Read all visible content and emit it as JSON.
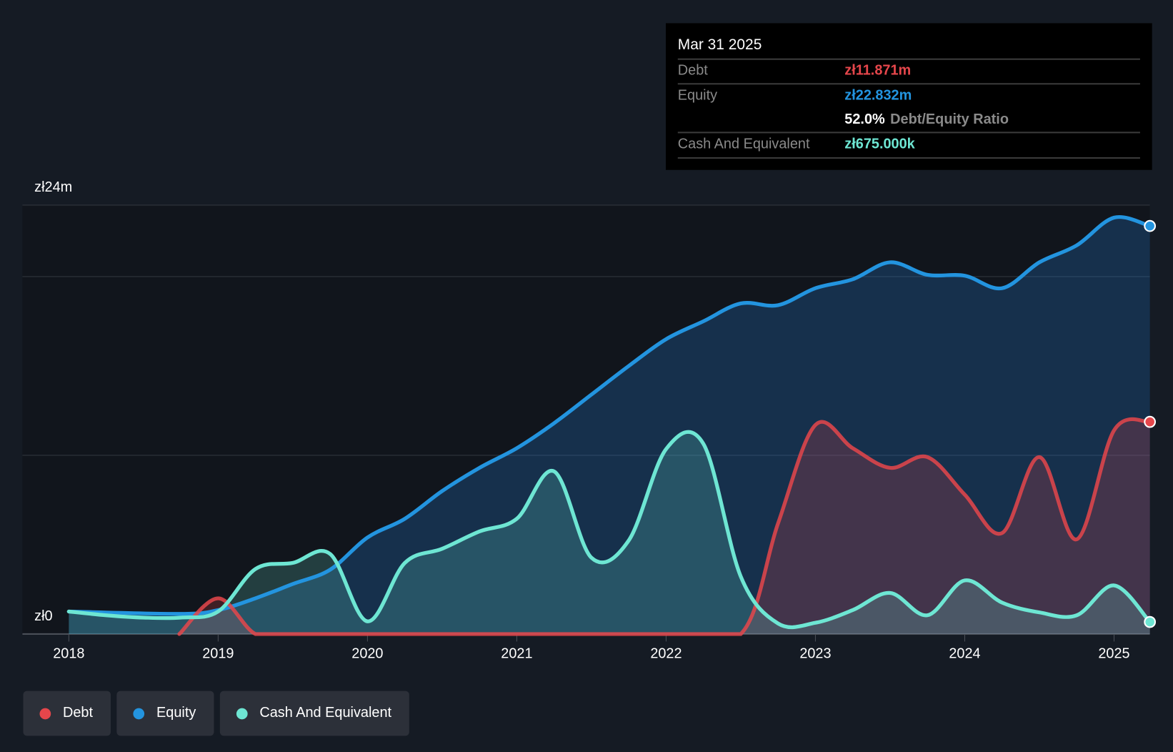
{
  "chart_data": {
    "type": "area",
    "title": "",
    "xlabel": "",
    "ylabel": "",
    "y_tick_labels": [
      "zł0",
      "zł24m"
    ],
    "ylim": [
      0,
      24
    ],
    "y_unit": "zł m",
    "x_tick_labels": [
      "2018",
      "2019",
      "2020",
      "2021",
      "2022",
      "2023",
      "2024",
      "2025"
    ],
    "xlim": [
      2017.7,
      2025.24
    ],
    "grid": true,
    "legend_placement": "bottom-left",
    "series": [
      {
        "name": "Debt",
        "color": "#e5464b",
        "x": [
          2018.74,
          2019.0,
          2019.25,
          2019.5,
          2020.0,
          2020.5,
          2021.0,
          2021.5,
          2022.0,
          2022.5,
          2022.75,
          2023.0,
          2023.25,
          2023.5,
          2023.75,
          2024.0,
          2024.25,
          2024.5,
          2024.75,
          2025.0,
          2025.24
        ],
        "values": [
          0,
          2.0,
          0,
          0,
          0,
          0,
          0,
          0,
          0,
          0,
          6.2,
          11.7,
          10.4,
          9.3,
          9.9,
          7.8,
          5.65,
          9.9,
          5.3,
          11.4,
          11.871
        ]
      },
      {
        "name": "Equity",
        "color": "#2394df",
        "x": [
          2018.0,
          2018.75,
          2019.0,
          2019.25,
          2019.5,
          2019.75,
          2020.0,
          2020.25,
          2020.5,
          2020.75,
          2021.0,
          2021.25,
          2021.5,
          2021.75,
          2022.0,
          2022.25,
          2022.5,
          2022.75,
          2023.0,
          2023.25,
          2023.5,
          2023.75,
          2024.0,
          2024.25,
          2024.5,
          2024.75,
          2025.0,
          2025.24
        ],
        "values": [
          1.26,
          1.13,
          1.34,
          2.0,
          2.8,
          3.6,
          5.4,
          6.45,
          8.0,
          9.3,
          10.4,
          11.8,
          13.4,
          15.0,
          16.5,
          17.5,
          18.5,
          18.4,
          19.35,
          19.85,
          20.8,
          20.1,
          20.05,
          19.35,
          20.8,
          21.75,
          23.3,
          22.832
        ]
      },
      {
        "name": "Cash And Equivalent",
        "color": "#6ee6d3",
        "x": [
          2018.0,
          2018.25,
          2018.5,
          2018.75,
          2019.0,
          2019.25,
          2019.5,
          2019.75,
          2020.0,
          2020.25,
          2020.5,
          2020.75,
          2021.0,
          2021.25,
          2021.5,
          2021.75,
          2022.0,
          2022.25,
          2022.5,
          2022.75,
          2023.0,
          2023.25,
          2023.5,
          2023.75,
          2024.0,
          2024.25,
          2024.5,
          2024.75,
          2025.0,
          2025.24
        ],
        "values": [
          1.26,
          1.05,
          0.92,
          0.92,
          1.26,
          3.64,
          3.98,
          4.48,
          0.71,
          3.98,
          4.77,
          5.74,
          6.45,
          9.1,
          4.27,
          5.24,
          10.35,
          10.64,
          3.22,
          0.59,
          0.63,
          1.34,
          2.3,
          1.05,
          3.0,
          1.76,
          1.21,
          1.05,
          2.72,
          0.675
        ]
      }
    ]
  },
  "tooltip": {
    "date": "Mar 31 2025",
    "debt_label": "Debt",
    "debt_value": "zł11.871m",
    "equity_label": "Equity",
    "equity_value": "zł22.832m",
    "ratio_value": "52.0%",
    "ratio_label": "Debt/Equity Ratio",
    "cash_label": "Cash And Equivalent",
    "cash_value": "zł675.000k"
  },
  "legend": [
    {
      "label": "Debt",
      "color": "#e5464b"
    },
    {
      "label": "Equity",
      "color": "#2394df"
    },
    {
      "label": "Cash And Equivalent",
      "color": "#6ee6d3"
    }
  ]
}
